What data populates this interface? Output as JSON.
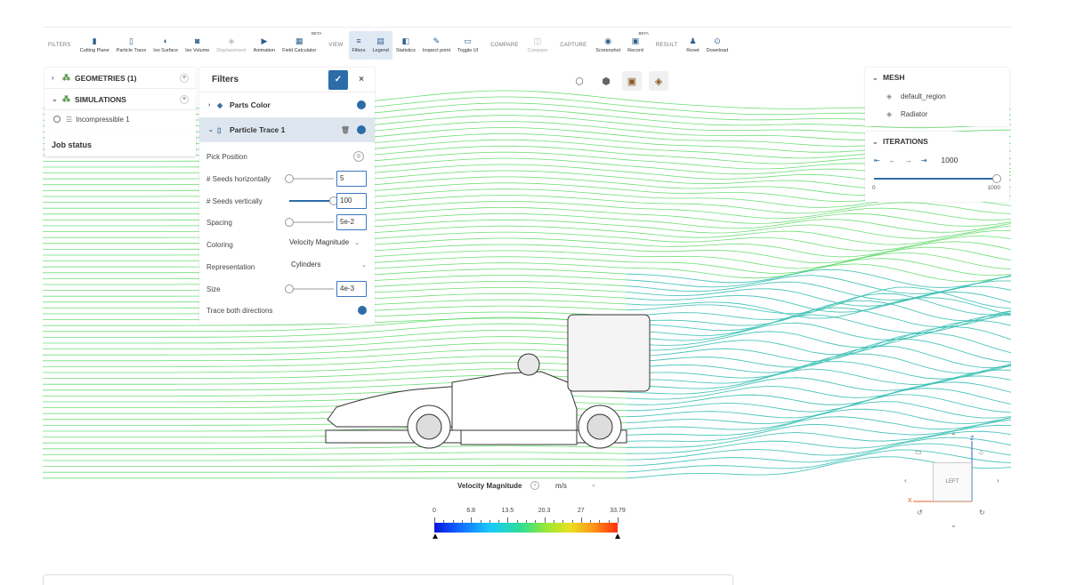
{
  "toolbar": {
    "groups": [
      {
        "label": "FILTERS",
        "buttons": [
          {
            "label": "Cutting Plane",
            "icon": "cutting-plane-icon",
            "glyph": "▮"
          },
          {
            "label": "Particle Trace",
            "icon": "particle-trace-icon",
            "glyph": "▯"
          },
          {
            "label": "Iso Surface",
            "icon": "iso-surface-icon",
            "glyph": "◐"
          },
          {
            "label": "Iso Volume",
            "icon": "iso-volume-icon",
            "glyph": "◙"
          },
          {
            "label": "Displacement",
            "icon": "displacement-icon",
            "glyph": "◈",
            "disabled": true
          },
          {
            "label": "Animation",
            "icon": "animation-icon",
            "glyph": "▶"
          },
          {
            "label": "Field Calculator",
            "icon": "field-calculator-icon",
            "glyph": "▦",
            "beta": "BETA"
          }
        ]
      },
      {
        "label": "VIEW",
        "buttons": [
          {
            "label": "Filters",
            "icon": "filters-icon",
            "glyph": "≡",
            "active": true
          },
          {
            "label": "Legend",
            "icon": "legend-icon",
            "glyph": "▤",
            "active": true
          },
          {
            "label": "Statistics",
            "icon": "statistics-icon",
            "glyph": "◧"
          },
          {
            "label": "Inspect point",
            "icon": "inspect-point-icon",
            "glyph": "✎"
          },
          {
            "label": "Toggle UI",
            "icon": "toggle-ui-icon",
            "glyph": "▭"
          }
        ]
      },
      {
        "label": "COMPARE",
        "buttons": [
          {
            "label": "Compare",
            "icon": "compare-icon",
            "glyph": "◫",
            "disabled": true
          }
        ]
      },
      {
        "label": "CAPTURE",
        "buttons": [
          {
            "label": "Screenshot",
            "icon": "screenshot-icon",
            "glyph": "◉"
          },
          {
            "label": "Record",
            "icon": "record-icon",
            "glyph": "▣",
            "beta": "BETA"
          }
        ]
      },
      {
        "label": "RESULT",
        "buttons": [
          {
            "label": "Reset",
            "icon": "reset-icon",
            "glyph": "♟"
          },
          {
            "label": "Download",
            "icon": "download-icon",
            "glyph": "⊙"
          }
        ]
      }
    ]
  },
  "tree": {
    "geometries_label": "GEOMETRIES (1)",
    "simulations_label": "SIMULATIONS",
    "simulation_item": "Incompressible 1",
    "job_status": "Job status"
  },
  "filters": {
    "title": "Filters",
    "confirm_glyph": "✓",
    "close_glyph": "×",
    "parts_color_label": "Parts Color",
    "particle_trace_label": "Particle Trace 1",
    "pick_position_label": "Pick Position",
    "seeds_h_label": "# Seeds horizontally",
    "seeds_h_value": "5",
    "seeds_h_level": 0.0,
    "seeds_v_label": "# Seeds vertically",
    "seeds_v_value": "100",
    "seeds_v_level": 1.0,
    "spacing_label": "Spacing",
    "spacing_value": "5e-2",
    "spacing_level": 0.0,
    "coloring_label": "Coloring",
    "coloring_value": "Velocity Magnitude",
    "representation_label": "Representation",
    "representation_value": "Cylinders",
    "size_label": "Size",
    "size_value": "4e-3",
    "size_level": 0.0,
    "trace_both_label": "Trace both directions"
  },
  "mesh": {
    "title": "MESH",
    "items": [
      "default_region",
      "Radiator"
    ]
  },
  "iterations": {
    "title": "ITERATIONS",
    "value": "1000",
    "min": "0",
    "max": "1000",
    "level": 1.0
  },
  "legend": {
    "title": "Velocity Magnitude",
    "unit": "m/s",
    "ticks": [
      "0",
      "6.8",
      "13.5",
      "20.3",
      "27",
      "33.79"
    ]
  },
  "nav_cube": {
    "face_label": "LEFT",
    "axis_z": "Z",
    "axis_x": "X"
  },
  "colors": {
    "accent": "#2c6ca8",
    "flow_green": "#3ed14a",
    "flow_cyan": "#3cb8e8"
  }
}
